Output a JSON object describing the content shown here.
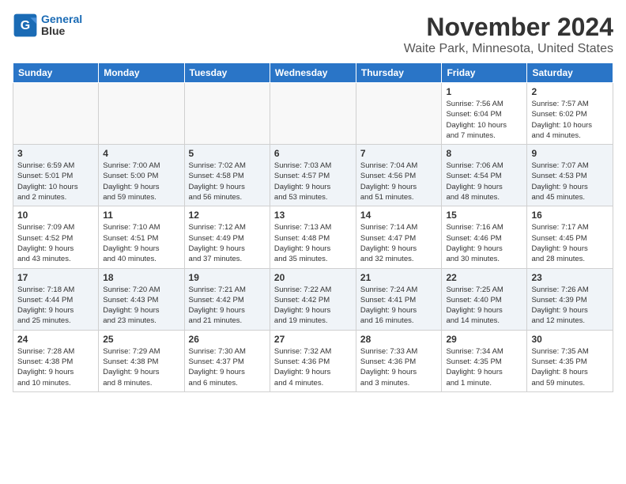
{
  "header": {
    "logo_line1": "General",
    "logo_line2": "Blue",
    "month": "November 2024",
    "location": "Waite Park, Minnesota, United States"
  },
  "weekdays": [
    "Sunday",
    "Monday",
    "Tuesday",
    "Wednesday",
    "Thursday",
    "Friday",
    "Saturday"
  ],
  "weeks": [
    [
      {
        "day": "",
        "info": ""
      },
      {
        "day": "",
        "info": ""
      },
      {
        "day": "",
        "info": ""
      },
      {
        "day": "",
        "info": ""
      },
      {
        "day": "",
        "info": ""
      },
      {
        "day": "1",
        "info": "Sunrise: 7:56 AM\nSunset: 6:04 PM\nDaylight: 10 hours\nand 7 minutes."
      },
      {
        "day": "2",
        "info": "Sunrise: 7:57 AM\nSunset: 6:02 PM\nDaylight: 10 hours\nand 4 minutes."
      }
    ],
    [
      {
        "day": "3",
        "info": "Sunrise: 6:59 AM\nSunset: 5:01 PM\nDaylight: 10 hours\nand 2 minutes."
      },
      {
        "day": "4",
        "info": "Sunrise: 7:00 AM\nSunset: 5:00 PM\nDaylight: 9 hours\nand 59 minutes."
      },
      {
        "day": "5",
        "info": "Sunrise: 7:02 AM\nSunset: 4:58 PM\nDaylight: 9 hours\nand 56 minutes."
      },
      {
        "day": "6",
        "info": "Sunrise: 7:03 AM\nSunset: 4:57 PM\nDaylight: 9 hours\nand 53 minutes."
      },
      {
        "day": "7",
        "info": "Sunrise: 7:04 AM\nSunset: 4:56 PM\nDaylight: 9 hours\nand 51 minutes."
      },
      {
        "day": "8",
        "info": "Sunrise: 7:06 AM\nSunset: 4:54 PM\nDaylight: 9 hours\nand 48 minutes."
      },
      {
        "day": "9",
        "info": "Sunrise: 7:07 AM\nSunset: 4:53 PM\nDaylight: 9 hours\nand 45 minutes."
      }
    ],
    [
      {
        "day": "10",
        "info": "Sunrise: 7:09 AM\nSunset: 4:52 PM\nDaylight: 9 hours\nand 43 minutes."
      },
      {
        "day": "11",
        "info": "Sunrise: 7:10 AM\nSunset: 4:51 PM\nDaylight: 9 hours\nand 40 minutes."
      },
      {
        "day": "12",
        "info": "Sunrise: 7:12 AM\nSunset: 4:49 PM\nDaylight: 9 hours\nand 37 minutes."
      },
      {
        "day": "13",
        "info": "Sunrise: 7:13 AM\nSunset: 4:48 PM\nDaylight: 9 hours\nand 35 minutes."
      },
      {
        "day": "14",
        "info": "Sunrise: 7:14 AM\nSunset: 4:47 PM\nDaylight: 9 hours\nand 32 minutes."
      },
      {
        "day": "15",
        "info": "Sunrise: 7:16 AM\nSunset: 4:46 PM\nDaylight: 9 hours\nand 30 minutes."
      },
      {
        "day": "16",
        "info": "Sunrise: 7:17 AM\nSunset: 4:45 PM\nDaylight: 9 hours\nand 28 minutes."
      }
    ],
    [
      {
        "day": "17",
        "info": "Sunrise: 7:18 AM\nSunset: 4:44 PM\nDaylight: 9 hours\nand 25 minutes."
      },
      {
        "day": "18",
        "info": "Sunrise: 7:20 AM\nSunset: 4:43 PM\nDaylight: 9 hours\nand 23 minutes."
      },
      {
        "day": "19",
        "info": "Sunrise: 7:21 AM\nSunset: 4:42 PM\nDaylight: 9 hours\nand 21 minutes."
      },
      {
        "day": "20",
        "info": "Sunrise: 7:22 AM\nSunset: 4:42 PM\nDaylight: 9 hours\nand 19 minutes."
      },
      {
        "day": "21",
        "info": "Sunrise: 7:24 AM\nSunset: 4:41 PM\nDaylight: 9 hours\nand 16 minutes."
      },
      {
        "day": "22",
        "info": "Sunrise: 7:25 AM\nSunset: 4:40 PM\nDaylight: 9 hours\nand 14 minutes."
      },
      {
        "day": "23",
        "info": "Sunrise: 7:26 AM\nSunset: 4:39 PM\nDaylight: 9 hours\nand 12 minutes."
      }
    ],
    [
      {
        "day": "24",
        "info": "Sunrise: 7:28 AM\nSunset: 4:38 PM\nDaylight: 9 hours\nand 10 minutes."
      },
      {
        "day": "25",
        "info": "Sunrise: 7:29 AM\nSunset: 4:38 PM\nDaylight: 9 hours\nand 8 minutes."
      },
      {
        "day": "26",
        "info": "Sunrise: 7:30 AM\nSunset: 4:37 PM\nDaylight: 9 hours\nand 6 minutes."
      },
      {
        "day": "27",
        "info": "Sunrise: 7:32 AM\nSunset: 4:36 PM\nDaylight: 9 hours\nand 4 minutes."
      },
      {
        "day": "28",
        "info": "Sunrise: 7:33 AM\nSunset: 4:36 PM\nDaylight: 9 hours\nand 3 minutes."
      },
      {
        "day": "29",
        "info": "Sunrise: 7:34 AM\nSunset: 4:35 PM\nDaylight: 9 hours\nand 1 minute."
      },
      {
        "day": "30",
        "info": "Sunrise: 7:35 AM\nSunset: 4:35 PM\nDaylight: 8 hours\nand 59 minutes."
      }
    ]
  ]
}
